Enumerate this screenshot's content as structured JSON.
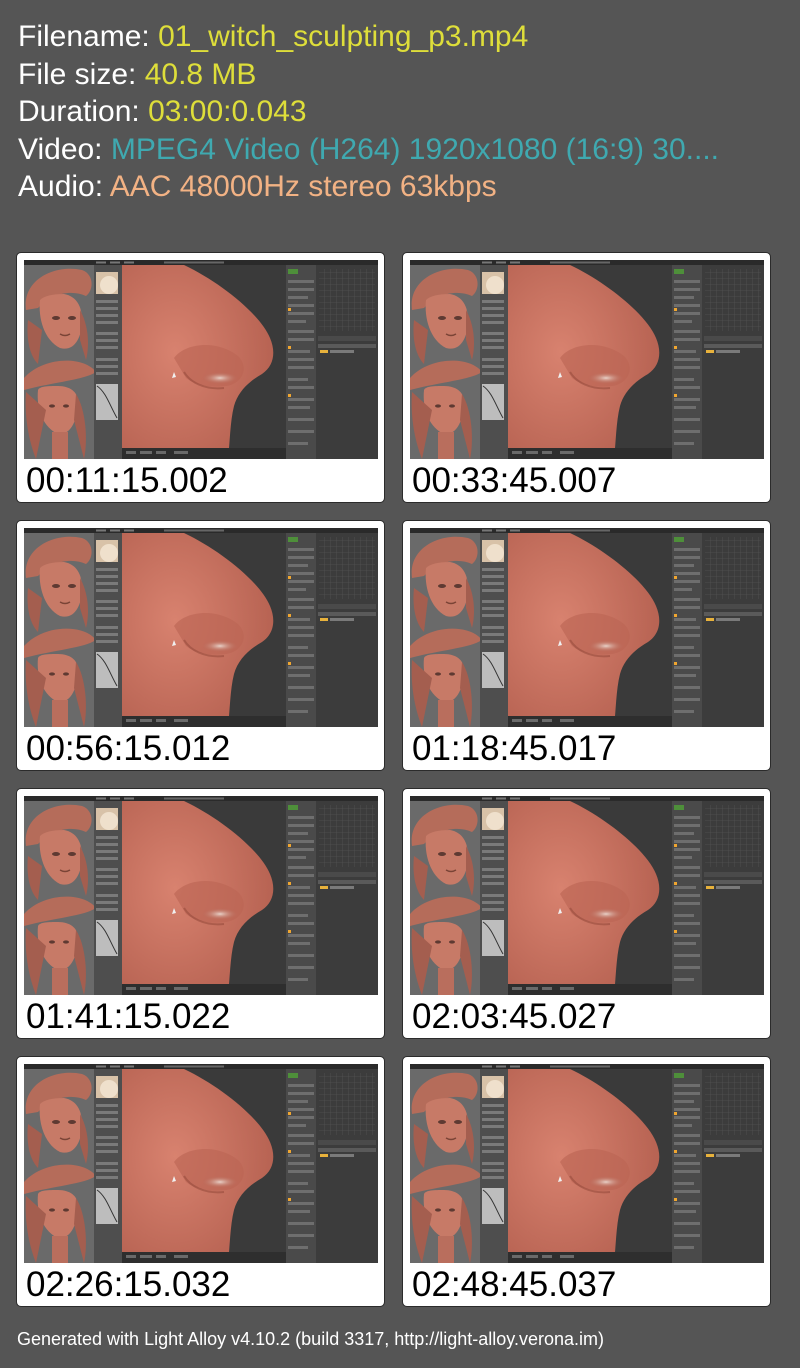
{
  "info": {
    "filename": {
      "label": "Filename:",
      "value": "01_witch_sculpting_p3.mp4"
    },
    "filesize": {
      "label": "File size:",
      "value": "40.8 MB"
    },
    "duration": {
      "label": "Duration:",
      "value": "03:00:0.043"
    },
    "video": {
      "label": "Video:",
      "value": "MPEG4 Video (H264) 1920x1080 (16:9) 30...."
    },
    "audio": {
      "label": "Audio:",
      "value": "AAC 48000Hz stereo 63kbps"
    }
  },
  "thumbnails": [
    {
      "time": "00:11:15.002"
    },
    {
      "time": "00:33:45.007"
    },
    {
      "time": "00:56:15.012"
    },
    {
      "time": "01:18:45.017"
    },
    {
      "time": "01:41:15.022"
    },
    {
      "time": "02:03:45.027"
    },
    {
      "time": "02:26:15.032"
    },
    {
      "time": "02:48:45.037"
    }
  ],
  "footer": "Generated with Light Alloy v4.10.2 (build 3317, http://light-alloy.verona.im)",
  "colors": {
    "background": "#555555",
    "label": "#ffffff",
    "filename_value": "#dede3a",
    "video_value": "#3fa9b0",
    "audio_value": "#f2b284",
    "skin": "#c8705f"
  }
}
